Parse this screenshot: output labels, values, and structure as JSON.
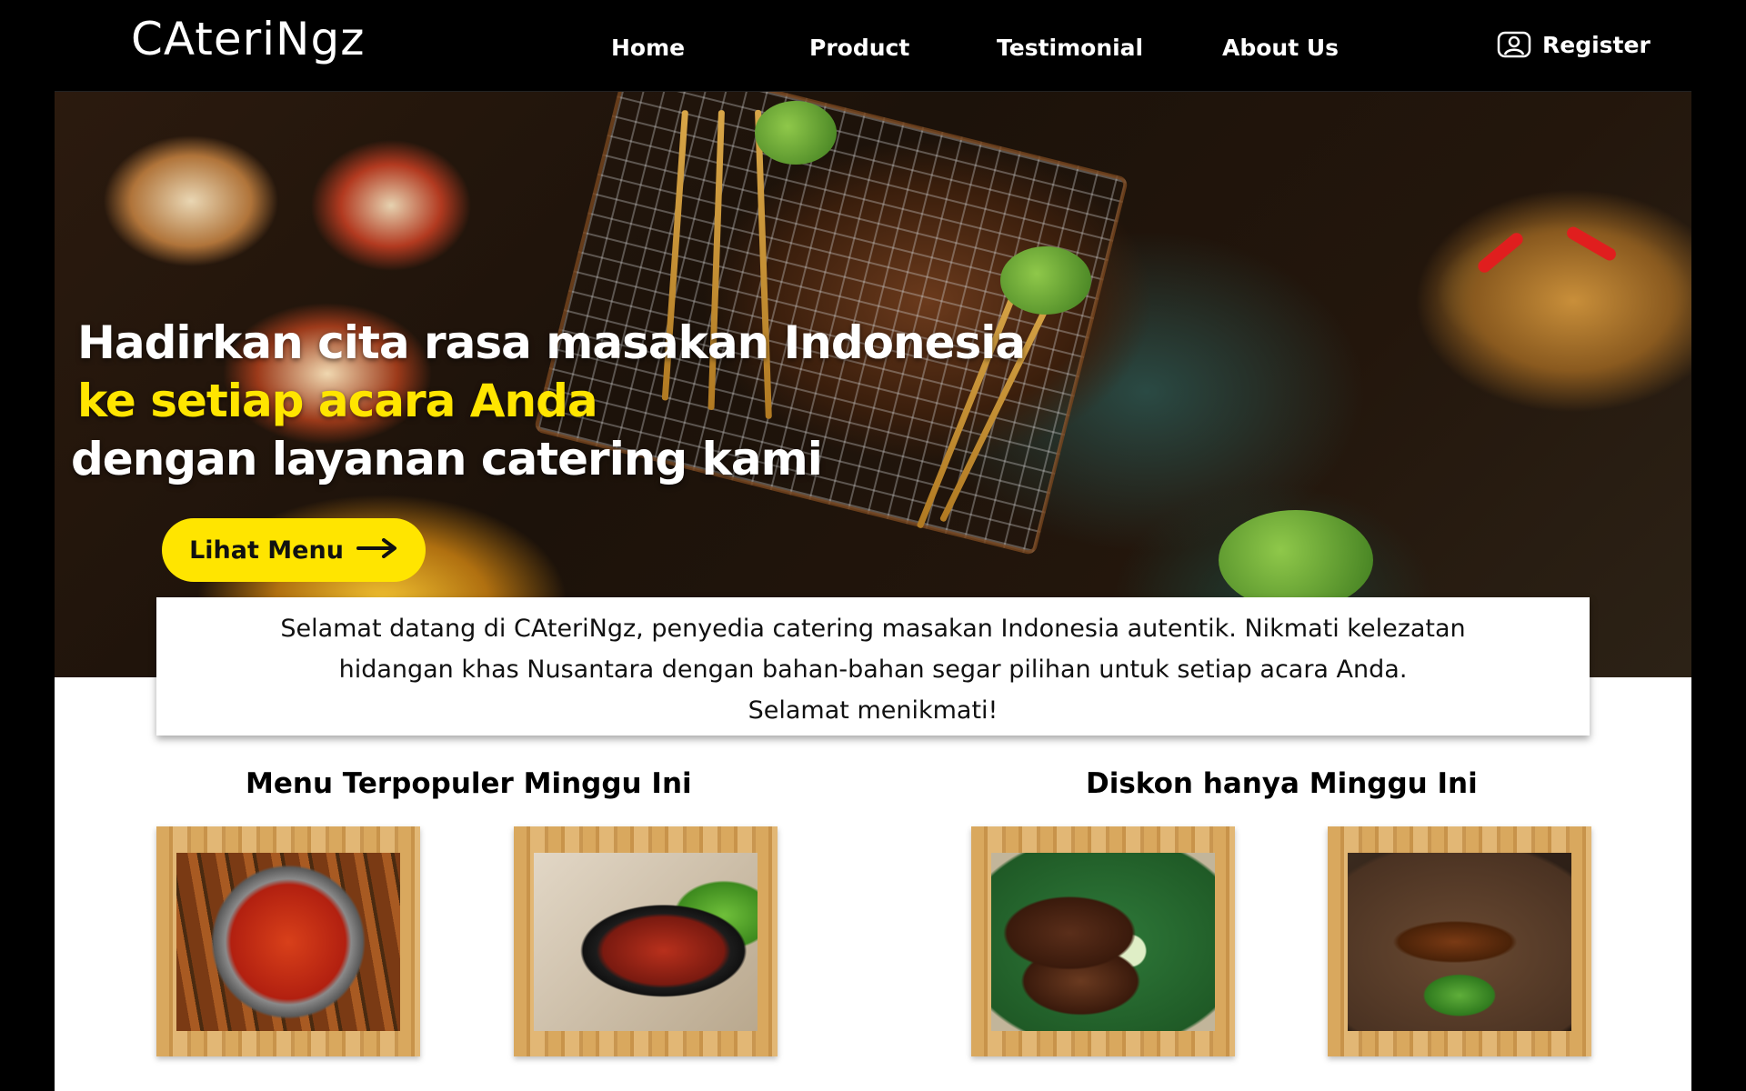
{
  "nav": {
    "logo": "CAteriNgz",
    "links": [
      "Home",
      "Product",
      "Testimonial",
      "About Us"
    ],
    "register_label": "Register",
    "register_icon": "user-icon"
  },
  "hero": {
    "line1": "Hadirkan cita rasa masakan Indonesia",
    "line2": "ke setiap acara Anda",
    "line3": "dengan layanan catering kami",
    "cta_label": "Lihat Menu",
    "cta_icon": "arrow-right-icon",
    "accent_color": "#ffe500"
  },
  "welcome": {
    "line1": "Selamat datang di CAteriNgz, penyedia catering masakan Indonesia autentik. Nikmati kelezatan",
    "line2": "hidangan khas Nusantara dengan bahan-bahan segar pilihan untuk setiap acara Anda.",
    "line3": "Selamat menikmati!"
  },
  "sections": {
    "popular_title": "Menu Terpopuler Minggu Ini",
    "discount_title": "Diskon hanya Minggu Ini"
  }
}
